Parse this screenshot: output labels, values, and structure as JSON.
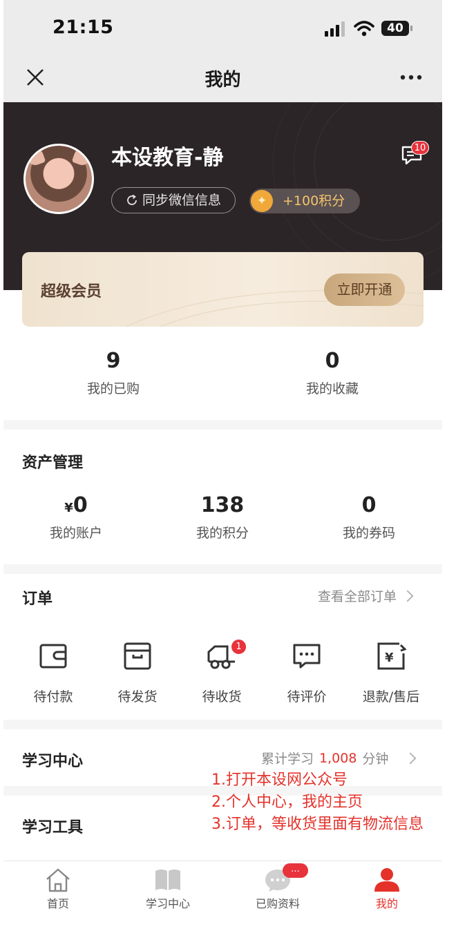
{
  "status_bar": {
    "time": "21:15",
    "battery": "40"
  },
  "nav": {
    "title": "我的"
  },
  "profile": {
    "username": "本设教育-静",
    "sync_label": "同步微信信息",
    "points_label": "+100积分",
    "message_badge": "10"
  },
  "vip": {
    "title": "超级会员",
    "button": "立即开通"
  },
  "stats": [
    {
      "value": "9",
      "label": "我的已购"
    },
    {
      "value": "0",
      "label": "我的收藏"
    }
  ],
  "assets": {
    "title": "资产管理",
    "items": [
      {
        "prefix": "¥",
        "value": "0",
        "label": "我的账户"
      },
      {
        "prefix": "",
        "value": "138",
        "label": "我的积分"
      },
      {
        "prefix": "",
        "value": "0",
        "label": "我的券码"
      }
    ]
  },
  "orders": {
    "title": "订单",
    "view_all": "查看全部订单",
    "items": [
      {
        "label": "待付款",
        "icon": "wallet-icon"
      },
      {
        "label": "待发货",
        "icon": "package-icon"
      },
      {
        "label": "待收货",
        "icon": "truck-icon",
        "badge": "1"
      },
      {
        "label": "待评价",
        "icon": "comment-icon"
      },
      {
        "label": "退款/售后",
        "icon": "refund-icon"
      }
    ]
  },
  "learning": {
    "title": "学习中心",
    "total_prefix": "累计学习",
    "total_value": "1,008",
    "total_unit": "分钟"
  },
  "tools": {
    "title": "学习工具"
  },
  "annotation": [
    "1.打开本设网公众号",
    "2.个人中心，我的主页",
    "3.订单，等收货里面有物流信息"
  ],
  "tabbar": {
    "items": [
      {
        "label": "首页",
        "icon": "home-icon"
      },
      {
        "label": "学习中心",
        "icon": "book-icon"
      },
      {
        "label": "已购资料",
        "icon": "chat-bubble-icon",
        "badge": "..."
      },
      {
        "label": "我的",
        "icon": "person-icon",
        "active": true
      }
    ]
  },
  "colors": {
    "accent": "#e4322b",
    "hero_bg": "#2b2527",
    "vip_bg": "#f3e7d6",
    "points": "#f0a83a"
  }
}
